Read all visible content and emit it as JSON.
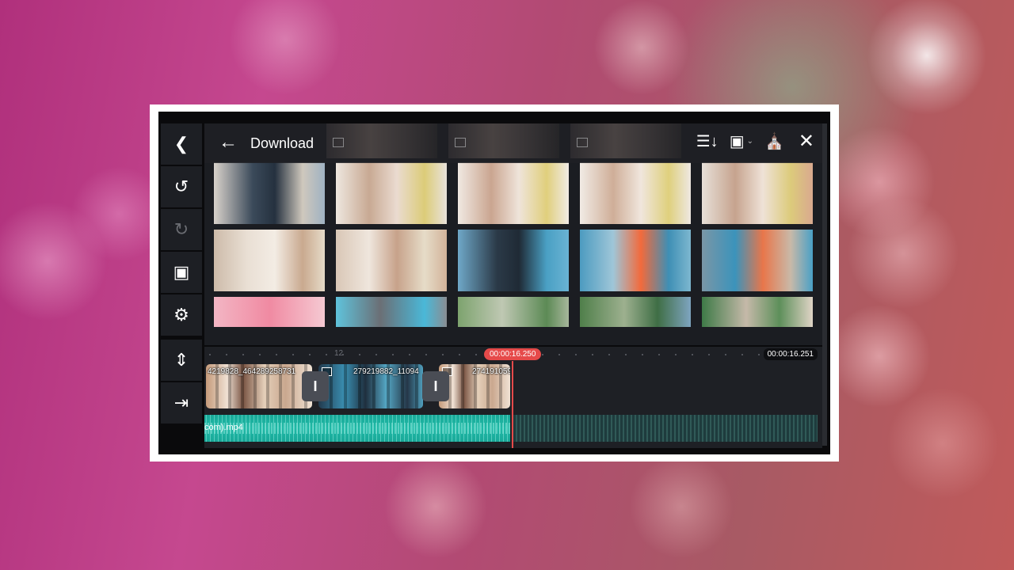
{
  "toolbar": {
    "icons": [
      "back-icon",
      "undo-icon",
      "redo-icon",
      "fullscreen-icon",
      "settings-icon",
      "split-icon",
      "import-icon"
    ]
  },
  "browser": {
    "folder_title": "Download",
    "top_icons": [
      "sort-icon",
      "image-filter-icon",
      "store-icon",
      "close-icon"
    ]
  },
  "timeline": {
    "tick_label": "12",
    "current_time": "00:00:16.250",
    "total_time": "00:00:16.251",
    "clips": [
      {
        "label": "4219828_464289258731",
        "style": "warm"
      },
      {
        "label": "279219882_11094",
        "style": "blue"
      },
      {
        "label": "274191059",
        "style": "warm"
      }
    ],
    "audio_label": "com).mp4"
  },
  "colors": {
    "accent_red": "#e64a4a",
    "audio_teal": "#1fb9a6",
    "panel": "#1e2025"
  }
}
